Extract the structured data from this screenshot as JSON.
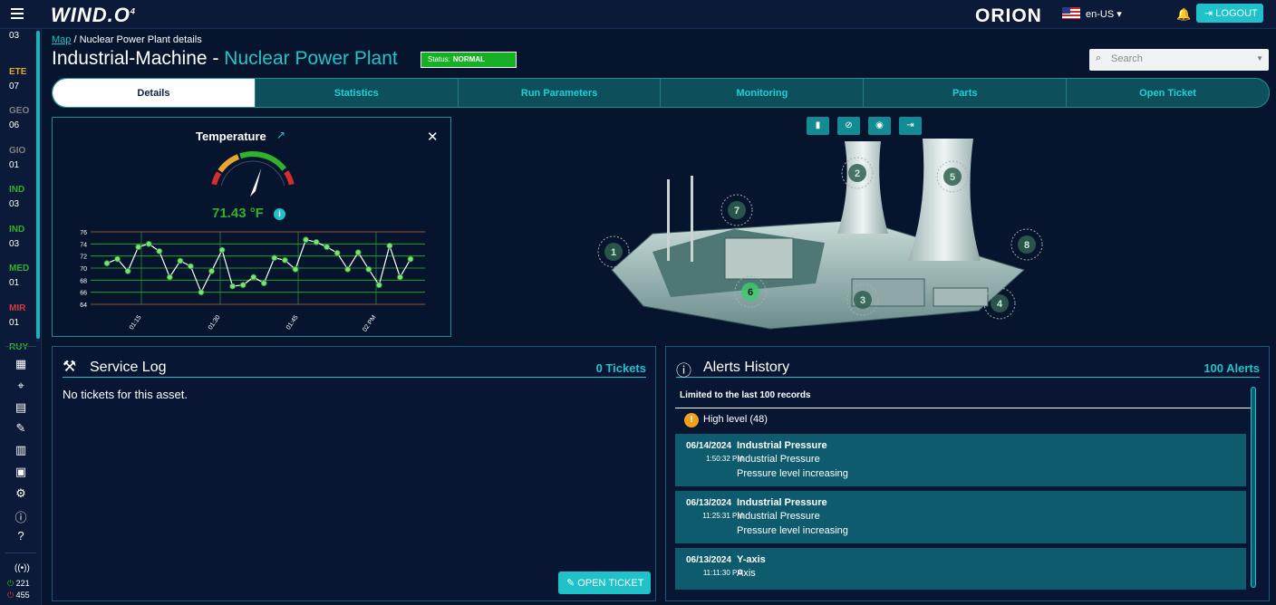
{
  "header": {
    "logo": "WIND.O",
    "logo_sup": "4",
    "brand": "ORION",
    "language": "en-US",
    "logout_label": "LOGOUT"
  },
  "sidebar": {
    "items": [
      {
        "code": "",
        "num": "03",
        "color": "#ffffff"
      },
      {
        "code": "ETE",
        "num": "07",
        "color": "#e8a530"
      },
      {
        "code": "GEO",
        "num": "06",
        "color": "#808080"
      },
      {
        "code": "GIO",
        "num": "01",
        "color": "#808080"
      },
      {
        "code": "IND",
        "num": "03",
        "color": "#2fb32a"
      },
      {
        "code": "IND",
        "num": "03",
        "color": "#2fb32a"
      },
      {
        "code": "MED",
        "num": "01",
        "color": "#2fb32a"
      },
      {
        "code": "MIR",
        "num": "01",
        "color": "#d43a3a"
      },
      {
        "code": "RUY",
        "num": "",
        "color": "#2fb32a"
      }
    ],
    "counters": {
      "online": "221",
      "offline": "455"
    }
  },
  "breadcrumb": {
    "link": "Map",
    "separator": "/",
    "current": "Nuclear Power Plant details"
  },
  "title": {
    "machine": "Industrial-Machine",
    "dash": "-",
    "plant": "Nuclear Power Plant"
  },
  "status": {
    "label": "Status:",
    "value": "NORMAL"
  },
  "search": {
    "placeholder": "Search"
  },
  "tabs": [
    "Details",
    "Statistics",
    "Run Parameters",
    "Monitoring",
    "Parts",
    "Open Ticket"
  ],
  "temperature": {
    "title": "Temperature",
    "value_label": "71.43 °F",
    "gauge_value": 71.43,
    "y_ticks": [
      "76",
      "74",
      "72",
      "70",
      "68",
      "66",
      "64"
    ],
    "x_ticks": [
      "01:15",
      "01:30",
      "01:45",
      "02 PM"
    ]
  },
  "chart_data": {
    "type": "line",
    "title": "Temperature",
    "ylim": [
      64,
      76
    ],
    "x_ticks": [
      "01:15",
      "01:30",
      "01:45",
      "02 PM"
    ],
    "values": [
      70.8,
      71.5,
      69.5,
      73.5,
      74.0,
      72.8,
      68.5,
      71.2,
      70.3,
      66.0,
      69.5,
      73.0,
      67.0,
      67.2,
      68.5,
      67.5,
      71.7,
      71.3,
      69.8,
      74.7,
      74.3,
      73.5,
      72.5,
      69.8,
      72.6,
      69.8,
      67.2,
      73.7,
      68.5,
      71.5
    ],
    "grid": true
  },
  "plant": {
    "markers": [
      "1",
      "2",
      "3",
      "4",
      "5",
      "6",
      "7",
      "8"
    ],
    "tools": [
      "document-icon",
      "eye-off-icon",
      "location-icon",
      "export-icon"
    ]
  },
  "service_log": {
    "title": "Service Log",
    "count": "0 Tickets",
    "empty_text": "No tickets for this asset.",
    "button": "OPEN TICKET"
  },
  "alerts": {
    "title": "Alerts History",
    "count": "100 Alerts",
    "limit_text": "Limited to the last 100 records",
    "level": "High level (48)",
    "items": [
      {
        "date": "06/14/2024",
        "time": "1:50:32 PM",
        "title": "Industrial Pressure",
        "line1": "Industrial Pressure",
        "line2": "Pressure level increasing"
      },
      {
        "date": "06/13/2024",
        "time": "11:25:31 PM",
        "title": "Industrial Pressure",
        "line1": "Industrial Pressure",
        "line2": "Pressure level increasing"
      },
      {
        "date": "06/13/2024",
        "time": "11:11:30 PM",
        "title": "Y-axis",
        "line1": "Axis",
        "line2": ""
      }
    ]
  }
}
